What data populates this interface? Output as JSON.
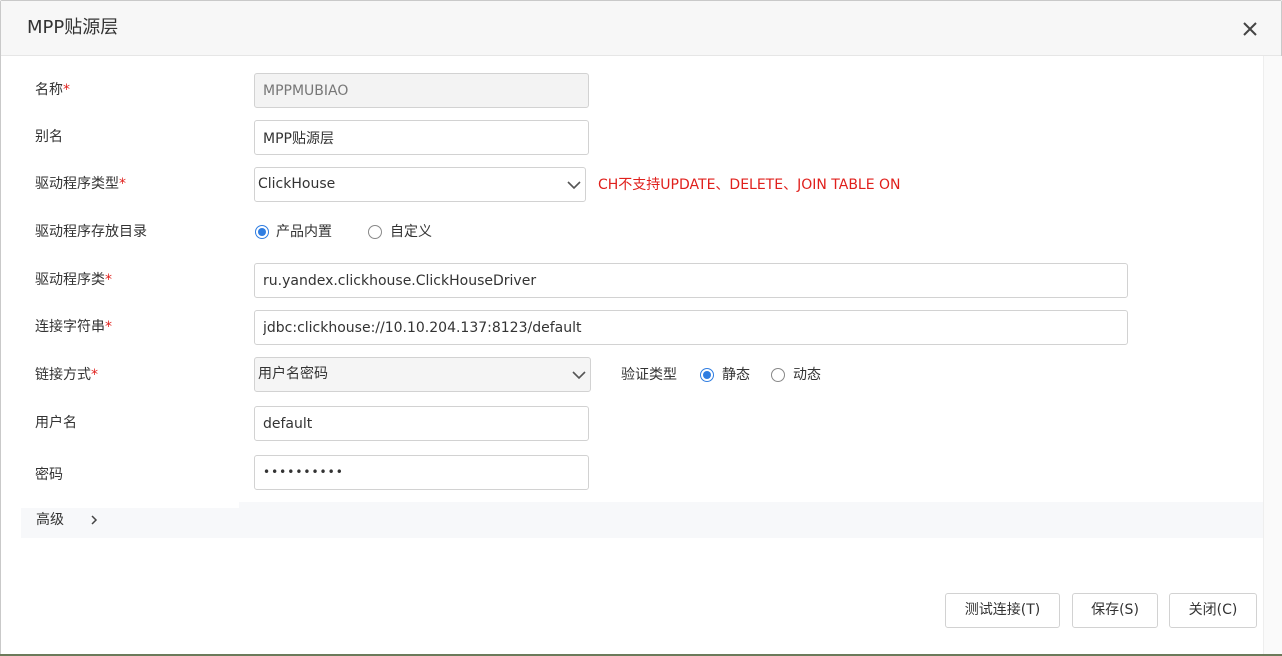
{
  "dialog": {
    "title": "MPP贴源层",
    "close_icon": "close-icon"
  },
  "form": {
    "name": {
      "label": "名称",
      "required": "*",
      "value": "MPPMUBIAO"
    },
    "alias": {
      "label": "别名",
      "value": "MPP贴源层"
    },
    "driver_type": {
      "label": "驱动程序类型",
      "required": "*",
      "value": "ClickHouse",
      "hint": "CH不支持UPDATE、DELETE、JOIN TABLE ON"
    },
    "driver_dir": {
      "label": "驱动程序存放目录",
      "options": [
        {
          "label": "产品内置",
          "checked": true
        },
        {
          "label": "自定义",
          "checked": false
        }
      ]
    },
    "driver_class": {
      "label": "驱动程序类",
      "required": "*",
      "value": "ru.yandex.clickhouse.ClickHouseDriver"
    },
    "connection_string": {
      "label": "连接字符串",
      "required": "*",
      "value": "jdbc:clickhouse://10.10.204.137:8123/default"
    },
    "link_mode": {
      "label": "链接方式",
      "required": "*",
      "value": "用户名密码",
      "auth_label": "验证类型",
      "auth_options": [
        {
          "label": "静态",
          "checked": true
        },
        {
          "label": "动态",
          "checked": false
        }
      ]
    },
    "username": {
      "label": "用户名",
      "value": "default"
    },
    "password": {
      "label": "密码",
      "value": "••••••••••"
    }
  },
  "advanced": {
    "label": "高级",
    "icon": "chevron-right-icon"
  },
  "buttons": {
    "test": "测试连接(T)",
    "save": "保存(S)",
    "close": "关闭(C)"
  },
  "colors": {
    "required": "#e0201c",
    "accent": "#2f7de1"
  }
}
